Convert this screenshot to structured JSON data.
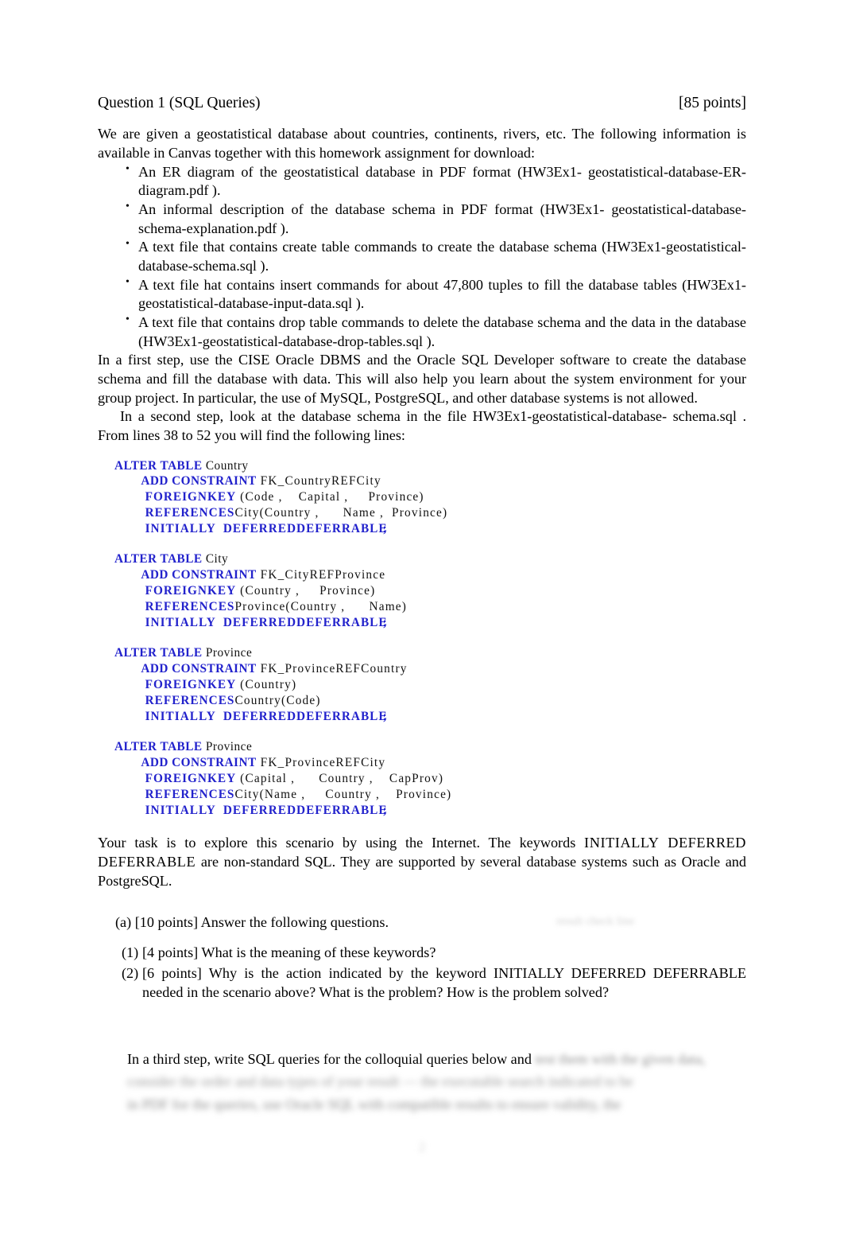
{
  "heading": {
    "title": "Question 1 (SQL Queries)",
    "points": "[85 points]"
  },
  "intro": "We are given a geostatistical database about countries, continents, rivers, etc. The following information is available in Canvas together with this homework assignment for download:",
  "bullets": [
    "An ER diagram of the geostatistical database in PDF format (HW3Ex1- geostatistical-database-ER-diagram.pdf ).",
    "An informal description of the database schema in PDF format (HW3Ex1- geostatistical-database-schema-explanation.pdf ).",
    "A text file that contains create table commands to create the database schema (HW3Ex1-geostatistical-database-schema.sql ).",
    "A text file hat contains insert commands for about 47,800 tuples to fill the database tables (HW3Ex1-geostatistical-database-input-data.sql ).",
    "A text file that contains drop table commands to delete the database schema and the data in the database (HW3Ex1-geostatistical-database-drop-tables.sql )."
  ],
  "paragraphs": {
    "first_step": "In a first step, use the CISE Oracle DBMS and the Oracle SQL Developer software to create the database schema and fill the database with data. This will also help you learn about the system environment for your group project. In particular, the use of MySQL, PostgreSQL, and other database systems is not allowed.",
    "second_step": "In a second step, look at the database schema in the file HW3Ex1-geostatistical-database- schema.sql . From lines 38 to 52 you will find the following lines:",
    "task_a": "Your task is to explore this scenario by using the Internet. The keywords ",
    "task_keywords": "INITIALLY  DEFERRED  DEFERRABLE",
    "task_b": " are non-standard SQL. They are supported by several database systems such as Oracle and PostgreSQL."
  },
  "sql_blocks": [
    {
      "name": "alter-country",
      "lines": [
        [
          {
            "t": "ALTER TABLE",
            "k": "kw"
          },
          {
            "t": " Country",
            "k": "id"
          }
        ],
        [
          {
            "t": "        ADD CONSTRAINT",
            "k": "kw"
          },
          {
            "t": " FK_CountryREFCity",
            "k": "idl"
          }
        ],
        [
          {
            "t": "        FOREIGNKEY",
            "k": "kw2"
          },
          {
            "t": " (Code ,    Capital ,     Province)",
            "k": "idl"
          }
        ],
        [
          {
            "t": "        REFERENCES",
            "k": "kw2"
          },
          {
            "t": "City(Country ,      Name ,  Province)",
            "k": "idl"
          }
        ],
        [
          {
            "t": "        INITIALLY  DEFERRED",
            "k": "kw2"
          },
          {
            "t": "DEFERRABLE",
            "k": "kw2"
          },
          {
            "t": ";",
            "k": "semi"
          }
        ]
      ]
    },
    {
      "name": "alter-city",
      "lines": [
        [
          {
            "t": "ALTER TABLE",
            "k": "kw"
          },
          {
            "t": " City",
            "k": "id"
          }
        ],
        [
          {
            "t": "        ADD CONSTRAINT",
            "k": "kw"
          },
          {
            "t": " FK_CityREFProvince",
            "k": "idl"
          }
        ],
        [
          {
            "t": "        FOREIGNKEY",
            "k": "kw2"
          },
          {
            "t": " (Country ,     Province)",
            "k": "idl"
          }
        ],
        [
          {
            "t": "        REFERENCES",
            "k": "kw2"
          },
          {
            "t": "Province(Country ,      Name)",
            "k": "idl"
          }
        ],
        [
          {
            "t": "        INITIALLY  DEFERRED",
            "k": "kw2"
          },
          {
            "t": "DEFERRABLE",
            "k": "kw2"
          },
          {
            "t": ";",
            "k": "semi"
          }
        ]
      ]
    },
    {
      "name": "alter-province-country",
      "lines": [
        [
          {
            "t": "ALTER TABLE",
            "k": "kw"
          },
          {
            "t": " Province",
            "k": "id"
          }
        ],
        [
          {
            "t": "        ADD CONSTRAINT",
            "k": "kw"
          },
          {
            "t": " FK_ProvinceREFCountry",
            "k": "idl"
          }
        ],
        [
          {
            "t": "        FOREIGNKEY",
            "k": "kw2"
          },
          {
            "t": " (Country)",
            "k": "idl"
          }
        ],
        [
          {
            "t": "        REFERENCES",
            "k": "kw2"
          },
          {
            "t": "Country(Code)",
            "k": "idl"
          }
        ],
        [
          {
            "t": "        INITIALLY  DEFERRED",
            "k": "kw2"
          },
          {
            "t": "DEFERRABLE",
            "k": "kw2"
          },
          {
            "t": ";",
            "k": "semi"
          }
        ]
      ]
    },
    {
      "name": "alter-province-city",
      "lines": [
        [
          {
            "t": "ALTER TABLE",
            "k": "kw"
          },
          {
            "t": " Province",
            "k": "id"
          }
        ],
        [
          {
            "t": "        ADD CONSTRAINT",
            "k": "kw"
          },
          {
            "t": " FK_ProvinceREFCity",
            "k": "idl"
          }
        ],
        [
          {
            "t": "        FOREIGNKEY",
            "k": "kw2"
          },
          {
            "t": " (Capital ,      Country ,    CapProv)",
            "k": "idl"
          }
        ],
        [
          {
            "t": "        REFERENCES",
            "k": "kw2"
          },
          {
            "t": "City(Name ,     Country ,    Province)",
            "k": "idl"
          }
        ],
        [
          {
            "t": "        INITIALLY  DEFERRED",
            "k": "kw2"
          },
          {
            "t": "DEFERRABLE",
            "k": "kw2"
          },
          {
            "t": ";",
            "k": "semi"
          }
        ]
      ]
    }
  ],
  "part_a": {
    "label": "(a) [10 points] Answer the following questions.",
    "subparts": [
      {
        "marker": "(1)",
        "text": "[4 points] What is the meaning of these keywords?"
      },
      {
        "marker": "(2)",
        "text": "[6 points] Why is the action indicated by the keyword INITIALLY  DEFERRED  DEFERRABLE needed in the scenario above? What is the problem? How is the problem solved?"
      }
    ]
  },
  "tail": {
    "visible": "In a third step, write SQL queries for the colloquial queries below and",
    "blurred_rest": " test them with the given data,",
    "blurred_line2": "consider the order and data types of your result  —  the executable search indicated to be",
    "blurred_line3": "in PDF for the queries, use Oracle SQL with compatible results to ensure validity, the"
  },
  "ghost": {
    "text": "result check line"
  },
  "page_number": "2",
  "colors": {
    "keyword_blue": "#2222cc",
    "text_black": "#000000",
    "blur_gray": "#8e8e8e"
  }
}
